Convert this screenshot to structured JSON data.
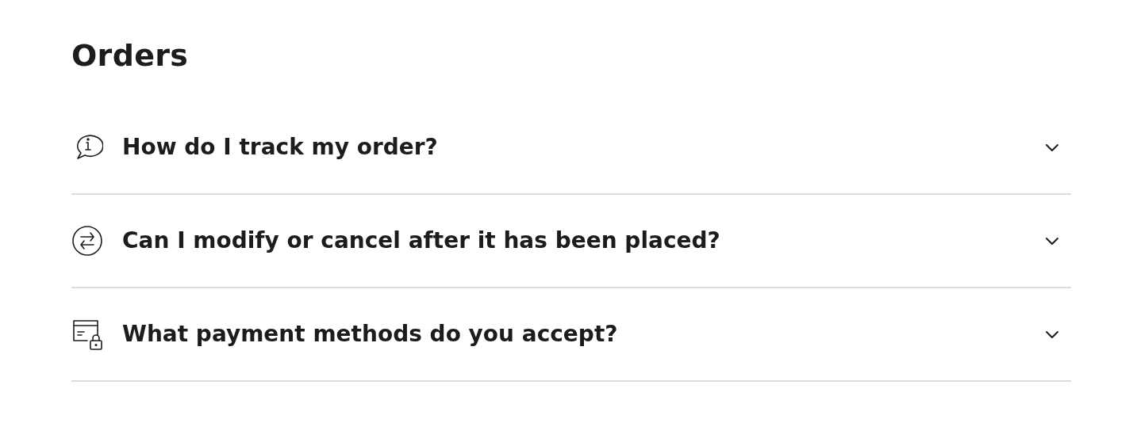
{
  "section": {
    "title": "Orders"
  },
  "faq": [
    {
      "kind": "info",
      "question": "How do I track my order?",
      "expanded": false
    },
    {
      "kind": "exchange",
      "question": "Can I modify or cancel after it has been placed?",
      "expanded": false
    },
    {
      "kind": "payment",
      "question": "What payment methods do you accept?",
      "expanded": false
    }
  ]
}
